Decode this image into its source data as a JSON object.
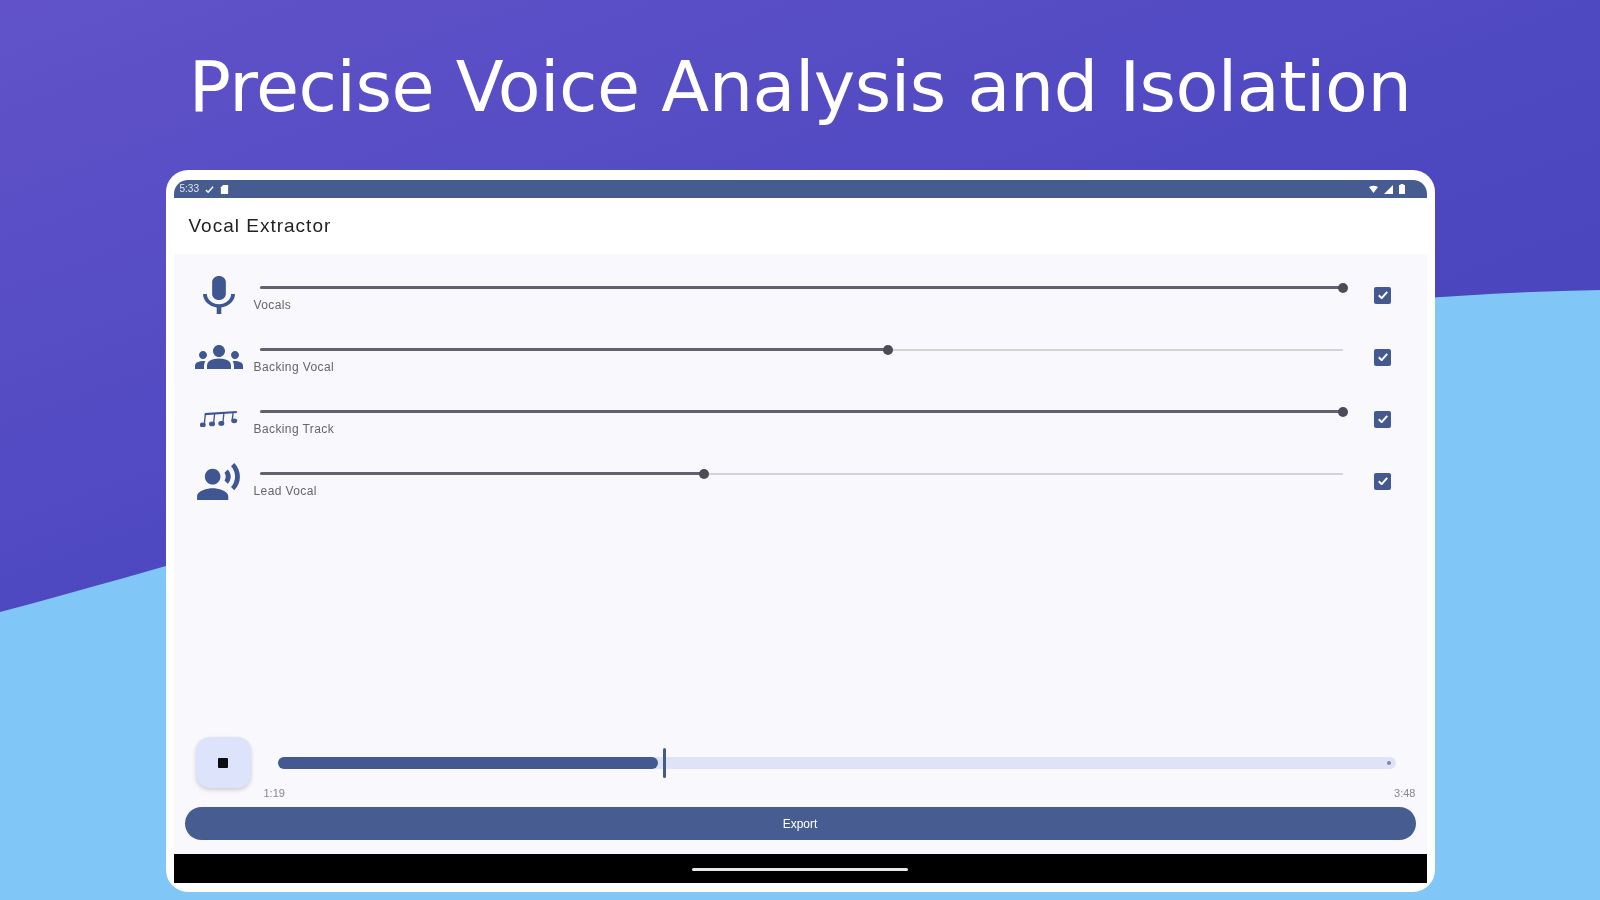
{
  "headline": "Precise Voice Analysis and Isolation",
  "status_bar": {
    "time": "5:33"
  },
  "app_bar": {
    "title": "Vocal Extractor"
  },
  "tracks": [
    {
      "kind": "mic",
      "label": "Vocals",
      "level": 1,
      "checked": true
    },
    {
      "kind": "group",
      "label": "Backing Vocal",
      "level": 0.58,
      "checked": true
    },
    {
      "kind": "notes",
      "label": "Backing Track",
      "level": 1,
      "checked": true
    },
    {
      "kind": "speaker",
      "label": "Lead Vocal",
      "level": 0.41,
      "checked": true
    }
  ],
  "player": {
    "playing": true,
    "progress": {
      "level": 0.346,
      "elapsed": "1:19",
      "duration": "3:48"
    }
  },
  "export_button": "Export"
}
